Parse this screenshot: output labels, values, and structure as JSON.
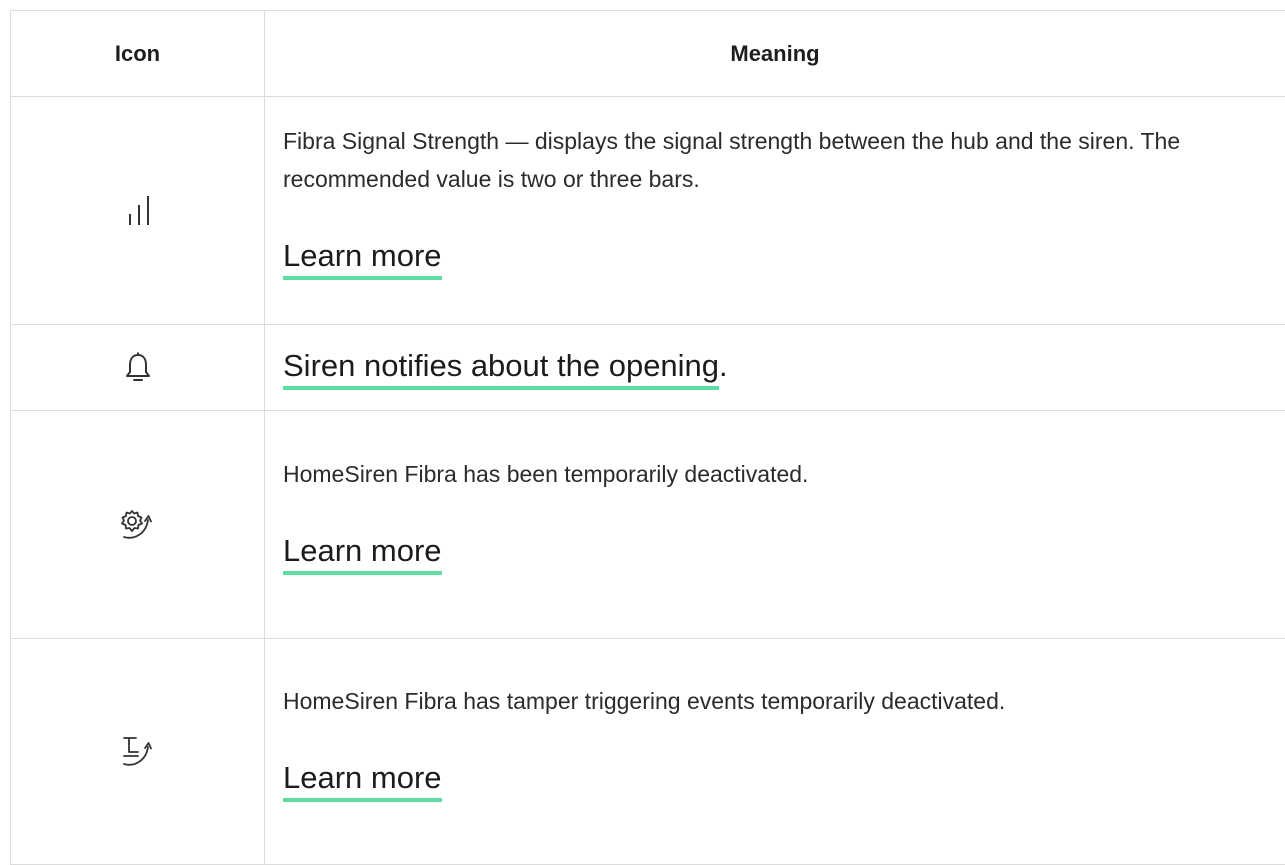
{
  "table": {
    "headers": {
      "icon": "Icon",
      "meaning": "Meaning"
    },
    "rows": [
      {
        "icon": "signal-strength-icon",
        "description": "Fibra Signal Strength — displays the signal strength between the hub and the siren. The recommended value is two or three bars.",
        "link": "Learn more"
      },
      {
        "icon": "bell-icon",
        "link": "Siren notifies about the opening",
        "suffix": "."
      },
      {
        "icon": "gear-arrow-icon",
        "description": "HomeSiren Fibra has been temporarily deactivated.",
        "link": "Learn more"
      },
      {
        "icon": "tamper-arrow-icon",
        "description": "HomeSiren Fibra has tamper triggering events temporarily deactivated.",
        "link": "Learn more"
      }
    ]
  },
  "colors": {
    "link_underline": "#5fdca3",
    "border": "#dcdcdc",
    "text": "#222222"
  }
}
